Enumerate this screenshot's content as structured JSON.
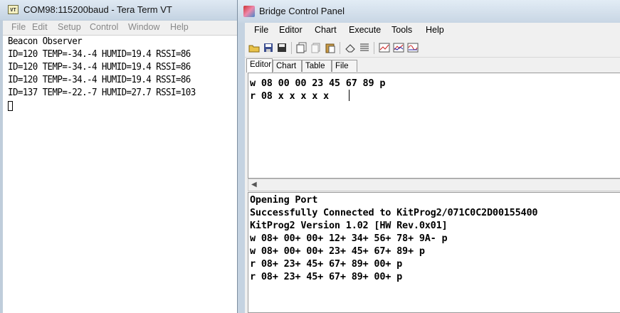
{
  "teraterm": {
    "title": "COM98:115200baud - Tera Term VT",
    "icon_text": "VT",
    "menu": [
      "File",
      "Edit",
      "Setup",
      "Control",
      "Window",
      "Help"
    ],
    "lines": [
      "Beacon Observer",
      "ID=120 TEMP=-34.-4 HUMID=19.4 RSSI=86",
      "ID=120 TEMP=-34.-4 HUMID=19.4 RSSI=86",
      "ID=120 TEMP=-34.-4 HUMID=19.4 RSSI=86",
      "ID=137 TEMP=-22.-7 HUMID=27.7 RSSI=103"
    ]
  },
  "bcp": {
    "title": "Bridge Control Panel",
    "menu": [
      "File",
      "Editor",
      "Chart",
      "Execute",
      "Tools",
      "Help"
    ],
    "tabs": [
      "Editor",
      "Chart",
      "Table",
      "File"
    ],
    "editor_lines": [
      "w 08 00 00 23 45 67 89 p",
      "r 08 x x x x x"
    ],
    "output_lines": [
      "Opening Port",
      "Successfully Connected to KitProg2/071C0C2D00155400",
      "KitProg2 Version 1.02 [HW Rev.0x01]",
      "w 08+ 00+ 00+ 12+ 34+ 56+ 78+ 9A- p",
      "w 08+ 00+ 00+ 23+ 45+ 67+ 89+ p",
      "r 08+ 23+ 45+ 67+ 89+ 00+ p",
      "r 08+ 23+ 45+ 67+ 89+ 00+ p"
    ]
  }
}
